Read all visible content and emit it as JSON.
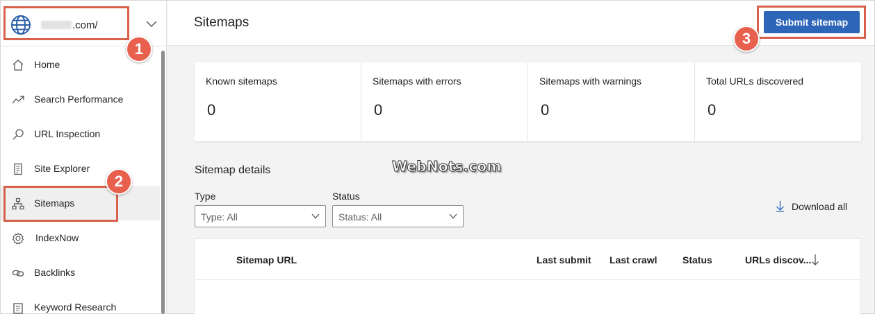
{
  "site": {
    "domain_suffix": ".com/"
  },
  "sidebar": {
    "items": [
      {
        "label": "Home",
        "icon": "home-icon"
      },
      {
        "label": "Search Performance",
        "icon": "trend-icon"
      },
      {
        "label": "URL Inspection",
        "icon": "search-icon"
      },
      {
        "label": "Site Explorer",
        "icon": "document-icon"
      },
      {
        "label": "Sitemaps",
        "icon": "sitemap-icon",
        "active": true
      },
      {
        "label": "IndexNow",
        "icon": "gear-icon"
      },
      {
        "label": "Backlinks",
        "icon": "link-icon"
      },
      {
        "label": "Keyword Research",
        "icon": "keyword-icon"
      }
    ]
  },
  "header": {
    "title": "Sitemaps",
    "submit_label": "Submit sitemap"
  },
  "stats": [
    {
      "label": "Known sitemaps",
      "value": "0"
    },
    {
      "label": "Sitemaps with errors",
      "value": "0"
    },
    {
      "label": "Sitemaps with warnings",
      "value": "0"
    },
    {
      "label": "Total URLs discovered",
      "value": "0"
    }
  ],
  "details": {
    "title": "Sitemap details",
    "type_label": "Type",
    "type_value": "Type: All",
    "status_label": "Status",
    "status_value": "Status: All",
    "download_label": "Download all"
  },
  "table": {
    "columns": [
      "Sitemap URL",
      "Last submit",
      "Last crawl",
      "Status",
      "URLs discov..."
    ]
  },
  "watermark": "WebNots.com",
  "annotations": [
    "1",
    "2",
    "3"
  ],
  "colors": {
    "accent": "#2d65b9",
    "annotation": "#e8604e"
  }
}
